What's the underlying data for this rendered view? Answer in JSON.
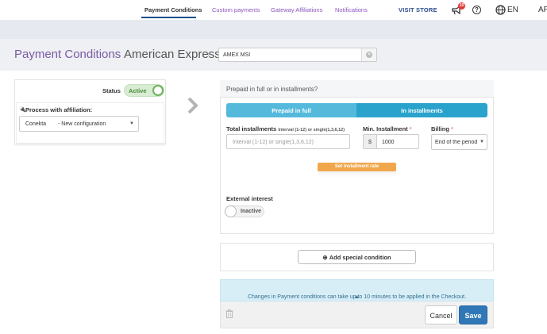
{
  "topbar": {
    "visit_store": "VISIT STORE",
    "notification_count": "10",
    "language": "EN",
    "user_abbr": "AF",
    "icons": [
      "megaphone-icon",
      "help-icon",
      "globe-icon"
    ]
  },
  "subnav": {
    "items": [
      {
        "label": "Payment Conditions",
        "active": true
      },
      {
        "label": "Custom payments",
        "active": false
      },
      {
        "label": "Gateway Affiliations",
        "active": false
      },
      {
        "label": "Notifications",
        "active": false
      }
    ]
  },
  "breadcrumb": {
    "title": "Payment Conditions",
    "separator": "›",
    "subtitle": "American Express",
    "name_value": "AMEX MSI"
  },
  "left_card": {
    "status_label": "Status",
    "status_value": "Active",
    "affiliation_label": "Process with affiliation:",
    "affiliation_gateway": "Conekta",
    "affiliation_config": "- New configuration"
  },
  "panel": {
    "heading": "Prepaid in full or in installments?",
    "tab_full": "Prepaid in full",
    "tab_installments": "In installments",
    "total_label": "Total installments",
    "total_hint": "Interval (1-12) or single(1,3,6,12)",
    "total_placeholder": "Interval (1-12) or single(1,3,6,12)",
    "min_label": "Min. Installment",
    "min_currency": "$",
    "min_value": "1000",
    "billing_label": "Billing",
    "billing_value": "End of the period",
    "required_mark": "*",
    "set_rate": "Set installment rate",
    "external_label": "External interest",
    "external_value": "Inactive"
  },
  "special": {
    "button": "Add special condition"
  },
  "info": {
    "message": "Changes in Payment conditions can take up to 10 minutes to be applied in the Checkout."
  },
  "footer": {
    "cancel": "Cancel",
    "save": "Save"
  },
  "colors": {
    "accent_purple": "#7b5aa6",
    "tab_blue": "#2aa3cc",
    "save_blue": "#2f77b6",
    "rate_orange": "#f0a74b",
    "active_green": "#6db35a"
  }
}
